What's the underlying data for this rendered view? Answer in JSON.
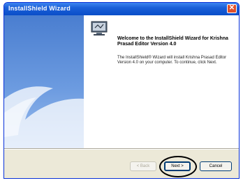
{
  "window": {
    "title": "InstallShield Wizard"
  },
  "content": {
    "welcome": "Welcome to the InstallShield Wizard for Krishna Prasad Editor Version 4.0",
    "description": "The InstallShield® Wizard will install Krishna Prasad Editor Version 4.0 on your computer. To continue, click Next."
  },
  "buttons": {
    "back": "< Back",
    "next": "Next >",
    "cancel": "Cancel"
  },
  "colors": {
    "titlebar": "#0a4ec8",
    "panel": "#4a7ed0",
    "dialog_bg": "#ece9d8",
    "close": "#e0502b"
  },
  "icons": {
    "close": "close-icon",
    "computer": "computer-icon"
  }
}
